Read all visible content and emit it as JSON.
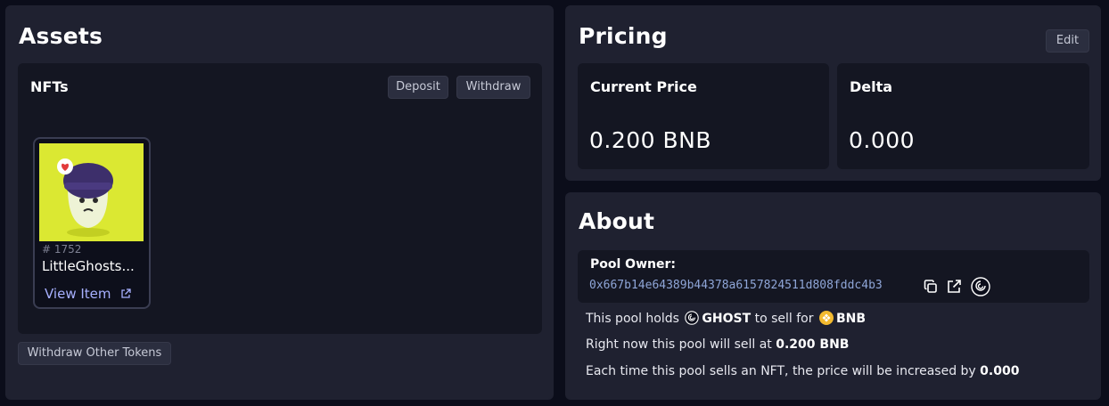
{
  "assets": {
    "title": "Assets",
    "nfts": {
      "title": "NFTs",
      "deposit_label": "Deposit",
      "withdraw_label": "Withdraw",
      "items": [
        {
          "id": "# 1752",
          "name": "LittleGhosts...",
          "link_label": "View Item"
        }
      ]
    },
    "withdraw_other_label": "Withdraw Other Tokens"
  },
  "pricing": {
    "title": "Pricing",
    "edit_label": "Edit",
    "current_price": {
      "label": "Current Price",
      "value": "0.200 BNB"
    },
    "delta": {
      "label": "Delta",
      "value": "0.000"
    }
  },
  "about": {
    "title": "About",
    "owner_label": "Pool Owner:",
    "owner_address": "0x667b14e64389b44378a6157824511d808fddc4b3",
    "line1": {
      "prefix": "This pool holds",
      "token": "GHOST",
      "middle": "to sell for",
      "currency": "BNB"
    },
    "line2": {
      "prefix": "Right now this pool will sell at",
      "value": "0.200 BNB"
    },
    "line3": {
      "prefix": "Each time this pool sells an NFT, the price will be increased by",
      "value": "0.000"
    }
  },
  "colors": {
    "background": "#0b0d1a",
    "panel": "#1f2130",
    "inner": "#141622",
    "link": "#a7b0ff",
    "address": "#8fa6d8",
    "bnb": "#f3ba2f",
    "nft_bg": "#dbe832"
  }
}
